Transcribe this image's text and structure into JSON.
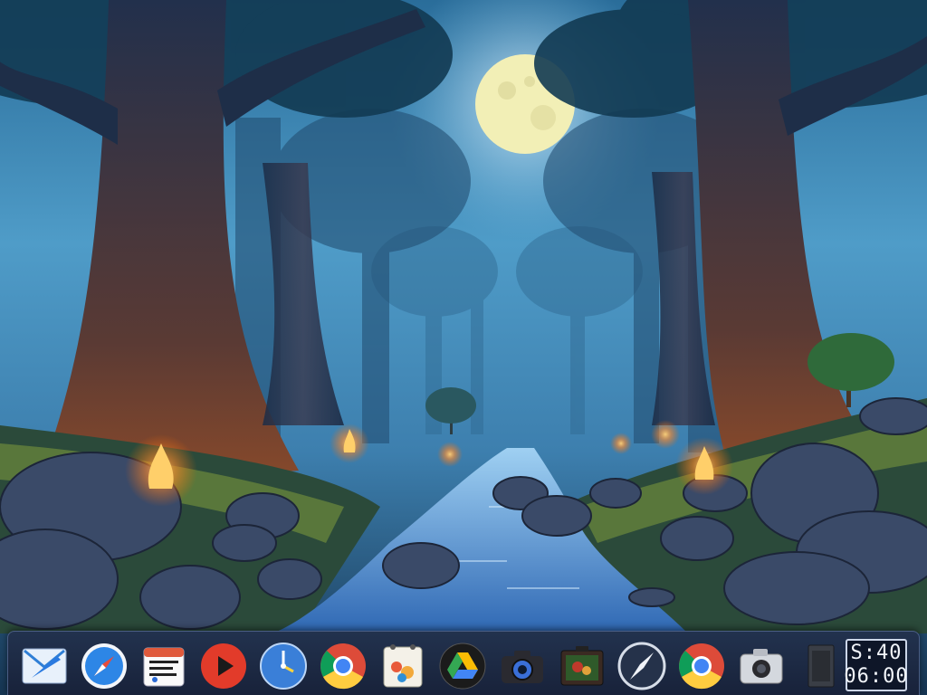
{
  "desktop": {
    "wallpaper": "moonlit-forest-river",
    "colors": {
      "sky": "#6fb4d8",
      "moon": "#f3f0b8",
      "river": "#4a8fd6",
      "fire": "#ffb24a",
      "dock": "#1c2a44"
    }
  },
  "dock": {
    "items": [
      {
        "id": "mail",
        "icon": "mail-icon"
      },
      {
        "id": "safari",
        "icon": "compass-icon"
      },
      {
        "id": "calendar",
        "icon": "calendar-icon"
      },
      {
        "id": "youtube",
        "icon": "play-icon"
      },
      {
        "id": "clock",
        "icon": "clock-icon"
      },
      {
        "id": "chrome",
        "icon": "chrome-icon"
      },
      {
        "id": "notes",
        "icon": "notepad-icon"
      },
      {
        "id": "drive",
        "icon": "drive-icon"
      },
      {
        "id": "camera",
        "icon": "camera-icon"
      },
      {
        "id": "photo-booth",
        "icon": "photo-case-icon"
      },
      {
        "id": "compass",
        "icon": "compass-dark-icon"
      },
      {
        "id": "chrome-2",
        "icon": "chrome-icon"
      },
      {
        "id": "screenshot",
        "icon": "camera-silver-icon"
      },
      {
        "id": "device",
        "icon": "device-icon"
      }
    ],
    "clock": {
      "line1": "S:40",
      "line2": "06:00"
    }
  }
}
